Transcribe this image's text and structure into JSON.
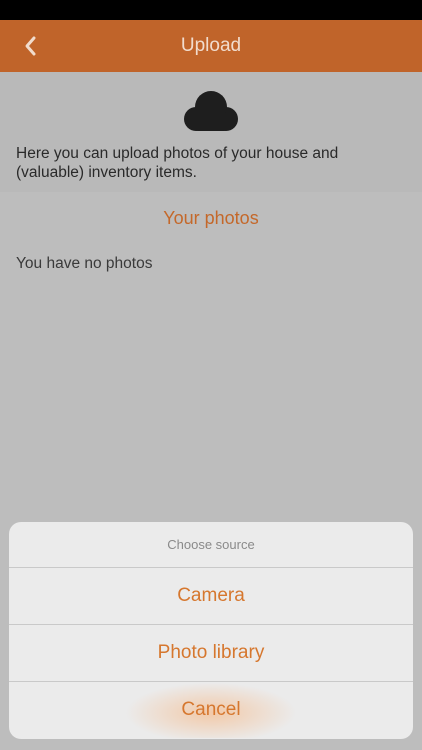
{
  "nav": {
    "title": "Upload",
    "back_icon": "chevron-left-icon",
    "color": "#c0642a"
  },
  "intro": {
    "icon": "cloud-icon",
    "text": "Here you can upload photos of your house and (valuable) inventory items."
  },
  "photos": {
    "title": "Your photos",
    "empty_text": "You have no photos"
  },
  "action_sheet": {
    "header": "Choose source",
    "options": [
      {
        "label": "Camera"
      },
      {
        "label": "Photo library"
      },
      {
        "label": "Cancel"
      }
    ],
    "accent": "#d6772e"
  }
}
